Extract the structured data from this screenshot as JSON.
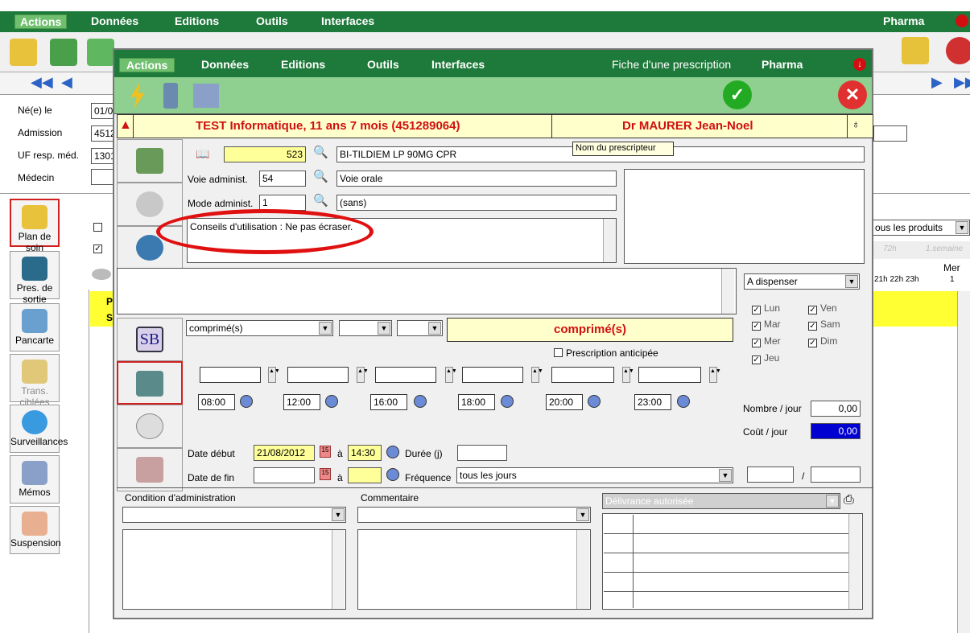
{
  "main_menu": {
    "actions": "Actions",
    "donnees": "Données",
    "editions": "Editions",
    "outils": "Outils",
    "interfaces": "Interfaces",
    "pharma": "Pharma"
  },
  "patient_info": {
    "ne_le_label": "Né(e) le",
    "ne_le_value": "01/0",
    "admission_label": "Admission",
    "admission_value": "4512",
    "uf_label": "UF resp. méd.",
    "uf_value": "1301",
    "medecin_label": "Médecin"
  },
  "sidebar": {
    "items": [
      {
        "label": "Plan de soin"
      },
      {
        "label": "Pres. de sortie"
      },
      {
        "label": "Pancarte"
      },
      {
        "label": "Trans. ciblées"
      },
      {
        "label": "Surveillances"
      },
      {
        "label": "Mémos"
      },
      {
        "label": "Suspension"
      }
    ]
  },
  "background_right": {
    "products_filter": "ous les produits",
    "col_72h": "72h",
    "col_semaine": "1.semaine",
    "day_header": "Mer",
    "hours": "21h 22h 23h",
    "day_number": "1",
    "row_p": "P",
    "row_s": "S"
  },
  "dialog": {
    "menu": {
      "actions": "Actions",
      "donnees": "Données",
      "editions": "Editions",
      "outils": "Outils",
      "interfaces": "Interfaces",
      "title": "Fiche d'une prescription",
      "pharma": "Pharma"
    },
    "patient": "TEST Informatique, 11 ans 7 mois (451289064)",
    "doctor": "Dr MAURER Jean-Noel",
    "tooltip": "Nom du prescripteur",
    "product_code": "523",
    "product_name": "BI-TILDIEM LP 90MG CPR",
    "voie_label": "Voie administ.",
    "voie_code": "54",
    "voie_value": "Voie orale",
    "mode_label": "Mode administ.",
    "mode_code": "1",
    "mode_value": "(sans)",
    "conseils": "Conseils d'utilisation : Ne pas écraser.",
    "dispense_value": "A dispenser",
    "days": [
      {
        "label": "Lun",
        "checked": true
      },
      {
        "label": "Ven",
        "checked": true
      },
      {
        "label": "Mar",
        "checked": true
      },
      {
        "label": "Sam",
        "checked": true
      },
      {
        "label": "Mer",
        "checked": true
      },
      {
        "label": "Dim",
        "checked": true
      },
      {
        "label": "Jeu",
        "checked": true
      }
    ],
    "unit_combo": "comprimé(s)",
    "unit_display": "comprimé(s)",
    "anticipee_label": "Prescription anticipée",
    "times": [
      "08:00",
      "12:00",
      "16:00",
      "18:00",
      "20:00",
      "23:00"
    ],
    "nombre_label": "Nombre / jour",
    "nombre_value": "0,00",
    "cout_label": "Coût / jour",
    "cout_value": "0,00",
    "date_debut_label": "Date début",
    "date_debut_value": "21/08/2012",
    "a_label": "à",
    "heure_debut": "14:30",
    "duree_label": "Durée (j)",
    "date_fin_label": "Date de fin",
    "frequence_label": "Fréquence",
    "frequence_value": "tous les jours",
    "slash": "/",
    "condition_label": "Condition d'administration",
    "commentaire_label": "Commentaire",
    "delivrance_placeholder": "Délivrance autorisée",
    "colors": {
      "menubar": "#1e7a3a",
      "toolbar": "#8fcf8f",
      "patient_text": "#d01010",
      "highlight_yellow": "#ffff99",
      "cost_blue": "#0000d0"
    }
  }
}
